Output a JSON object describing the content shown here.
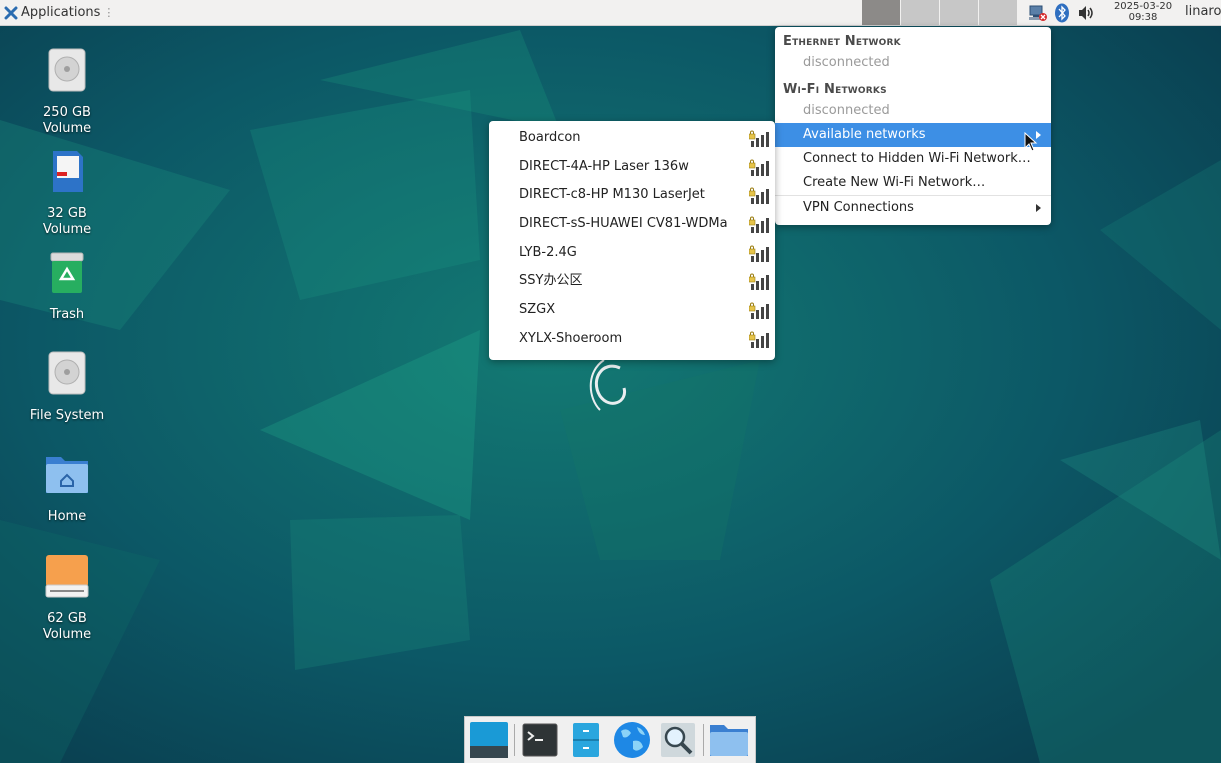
{
  "top_panel": {
    "applications_label": "Applications",
    "workspaces": [
      {
        "active": true
      },
      {
        "active": false
      },
      {
        "active": false
      },
      {
        "active": false
      }
    ],
    "tray_icons": [
      "network-disconnected-icon",
      "bluetooth-icon",
      "volume-icon"
    ],
    "clock": {
      "date": "2025-03-20",
      "time": "09:38"
    },
    "user": "linaro"
  },
  "desktop_icons": [
    {
      "icon": "drive-harddisk-icon",
      "line1": "250 GB",
      "line2": "Volume"
    },
    {
      "icon": "sd-card-icon",
      "line1": "32 GB",
      "line2": "Volume"
    },
    {
      "icon": "trash-icon",
      "line1": "Trash",
      "line2": ""
    },
    {
      "icon": "drive-harddisk-icon",
      "line1": "File System",
      "line2": ""
    },
    {
      "icon": "home-folder-icon",
      "line1": "Home",
      "line2": ""
    },
    {
      "icon": "removable-drive-icon",
      "line1": "62 GB",
      "line2": "Volume"
    }
  ],
  "network_menu": {
    "ethernet_header": "Ethernet Network",
    "ethernet_status": "disconnected",
    "wifi_header": "Wi-Fi Networks",
    "wifi_status": "disconnected",
    "available_networks": "Available networks",
    "connect_hidden": "Connect to Hidden Wi-Fi Network…",
    "create_new": "Create New Wi-Fi Network…",
    "vpn": "VPN Connections"
  },
  "wifi_networks": [
    {
      "ssid": "Boardcon",
      "secured": true
    },
    {
      "ssid": "DIRECT-4A-HP Laser 136w",
      "secured": true
    },
    {
      "ssid": "DIRECT-c8-HP M130 LaserJet",
      "secured": true
    },
    {
      "ssid": "DIRECT-sS-HUAWEI CV81-WDMa",
      "secured": true
    },
    {
      "ssid": "LYB-2.4G",
      "secured": true
    },
    {
      "ssid": "SSY办公区",
      "secured": true
    },
    {
      "ssid": "SZGX",
      "secured": true
    },
    {
      "ssid": "XYLX-Shoeroom",
      "secured": true
    }
  ],
  "dock": [
    "show-desktop-icon",
    "terminal-icon",
    "file-manager-icon",
    "web-browser-icon",
    "app-finder-icon",
    "folder-icon"
  ],
  "colors": {
    "accent": "#3d8fe5",
    "desktop": "#0d4b5c"
  }
}
